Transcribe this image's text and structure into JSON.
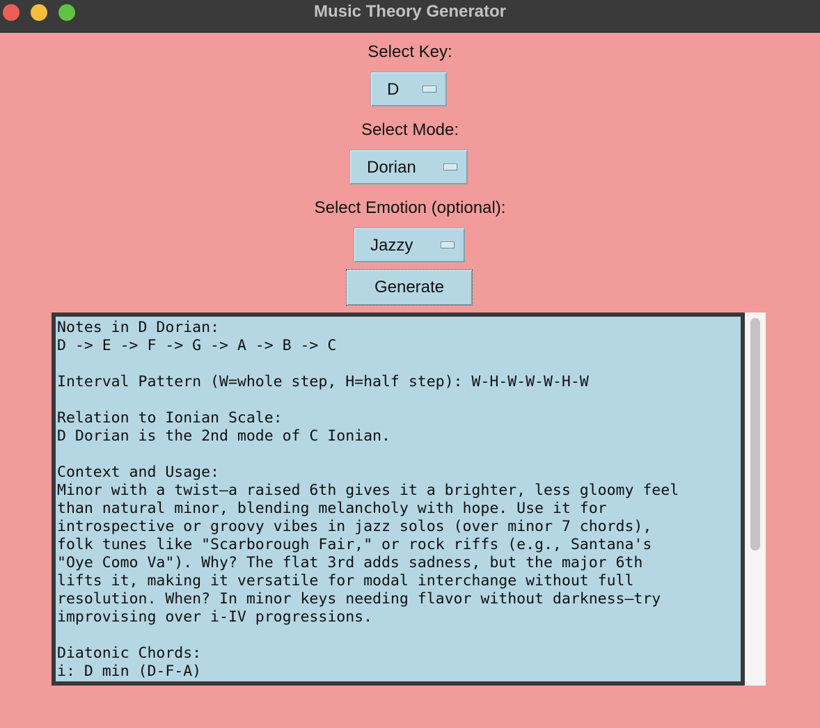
{
  "window": {
    "title": "Music Theory Generator"
  },
  "key": {
    "label": "Select Key:",
    "value": "D"
  },
  "mode": {
    "label": "Select Mode:",
    "value": "Dorian"
  },
  "emotion": {
    "label": "Select Emotion (optional):",
    "value": "Jazzy"
  },
  "generate_label": "Generate",
  "output": {
    "text": "Notes in D Dorian:\nD -> E -> F -> G -> A -> B -> C\n\nInterval Pattern (W=whole step, H=half step): W-H-W-W-W-H-W\n\nRelation to Ionian Scale:\nD Dorian is the 2nd mode of C Ionian.\n\nContext and Usage:\nMinor with a twist—a raised 6th gives it a brighter, less gloomy feel\nthan natural minor, blending melancholy with hope. Use it for\nintrospective or groovy vibes in jazz solos (over minor 7 chords),\nfolk tunes like \"Scarborough Fair,\" or rock riffs (e.g., Santana's\n\"Oye Como Va\"). Why? The flat 3rd adds sadness, but the major 6th\nlifts it, making it versatile for modal interchange without full\nresolution. When? In minor keys needing flavor without darkness—try\nimprovising over i-IV progressions.\n\nDiatonic Chords:\ni: D min (D-F-A)"
  },
  "colors": {
    "background": "#f19c9b",
    "widget": "#b5d7e3",
    "titlebar": "#3a3a3a"
  }
}
